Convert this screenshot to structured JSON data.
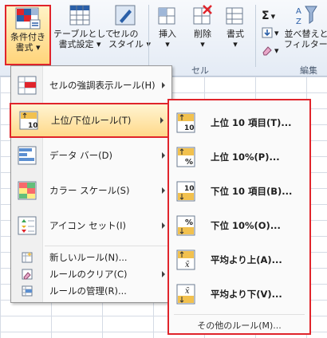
{
  "ribbon": {
    "conditional_formatting": {
      "line1": "条件付き",
      "line2": "書式"
    },
    "format_as_table": {
      "line1": "テーブルとして",
      "line2": "書式設定"
    },
    "cell_styles": {
      "line1": "セルの",
      "line2": "スタイル"
    },
    "insert": "挿入",
    "delete": "削除",
    "format": "書式",
    "sigma": "Σ",
    "sort_filter": {
      "line1": "並べ替えと",
      "line2": "フィルター"
    },
    "group_cells": "セル",
    "group_editing": "編集"
  },
  "menu": {
    "items": [
      {
        "label": "セルの強調表示ルール(H)",
        "icon": "highlight-cells-rules-icon"
      },
      {
        "label": "上位/下位ルール(T)",
        "icon": "top-bottom-rules-icon"
      },
      {
        "label": "データ バー(D)",
        "icon": "data-bars-icon"
      },
      {
        "label": "カラー スケール(S)",
        "icon": "color-scales-icon"
      },
      {
        "label": "アイコン セット(I)",
        "icon": "icon-sets-icon"
      }
    ],
    "small_items": [
      {
        "label": "新しいルール(N)...",
        "icon": "new-rule-icon"
      },
      {
        "label": "ルールのクリア(C)",
        "icon": "clear-rules-icon"
      },
      {
        "label": "ルールの管理(R)...",
        "icon": "manage-rules-icon"
      }
    ]
  },
  "submenu": {
    "items": [
      {
        "label": "上位 10 項目(T)...",
        "icon": "top-10-items-icon"
      },
      {
        "label": "上位 10%(P)...",
        "icon": "top-10-percent-icon"
      },
      {
        "label": "下位 10 項目(B)...",
        "icon": "bottom-10-items-icon"
      },
      {
        "label": "下位 10%(O)...",
        "icon": "bottom-10-percent-icon"
      },
      {
        "label": "平均より上(A)...",
        "icon": "above-average-icon"
      },
      {
        "label": "平均より下(V)...",
        "icon": "below-average-icon"
      }
    ],
    "more": "その他のルール(M)..."
  },
  "colors": {
    "highlight_border": "#e0242b",
    "accent_blue": "#2a5fa8"
  }
}
